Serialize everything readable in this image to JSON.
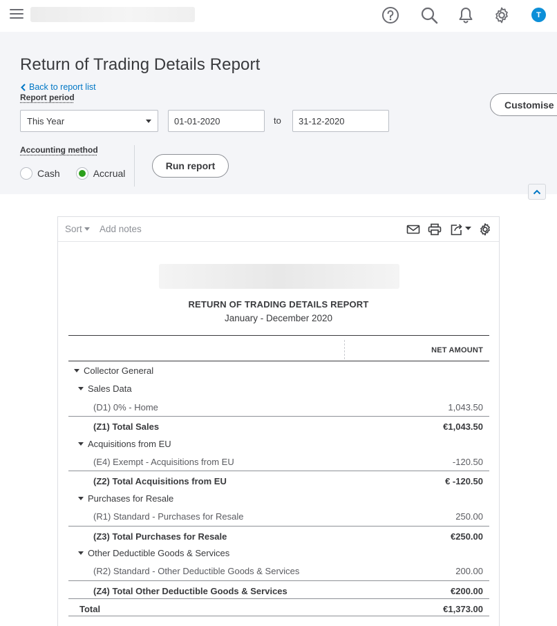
{
  "header": {
    "title": "Return of Trading Details Report",
    "back_label": "Back to report list",
    "report_period_label": "Report period",
    "period_value": "This Year",
    "start_date": "01-01-2020",
    "to_label": "to",
    "end_date": "31-12-2020",
    "customise_label": "Customise",
    "accounting_method_label": "Accounting method",
    "methods": [
      "Cash",
      "Accrual"
    ],
    "selected_method": "Accrual",
    "run_label": "Run report"
  },
  "topbar": {
    "avatar_initial": "T",
    "icons": [
      "help-icon",
      "search-icon",
      "bell-icon",
      "gear-icon"
    ]
  },
  "toolbar": {
    "sort_label": "Sort",
    "notes_label": "Add notes",
    "icons": [
      "email-icon",
      "print-icon",
      "export-icon",
      "settings-icon"
    ]
  },
  "report": {
    "title": "RETURN OF TRADING DETAILS REPORT",
    "period": "January - December 2020",
    "column_header": "NET AMOUNT",
    "rows": [
      {
        "label": "Collector General",
        "amount": "",
        "type": "group",
        "level": 0
      },
      {
        "label": "Sales Data",
        "amount": "",
        "type": "group",
        "level": 1
      },
      {
        "label": "(D1) 0% - Home",
        "amount": "1,043.50",
        "type": "detail",
        "level": 2
      },
      {
        "label": "(Z1) Total Sales",
        "amount": "€1,043.50",
        "type": "total",
        "level": 2
      },
      {
        "label": "Acquisitions from EU",
        "amount": "",
        "type": "group",
        "level": 1
      },
      {
        "label": "(E4) Exempt - Acquisitions from EU",
        "amount": "-120.50",
        "type": "detail",
        "level": 2
      },
      {
        "label": "(Z2) Total Acquisitions from EU",
        "amount": "€ -120.50",
        "type": "total",
        "level": 2
      },
      {
        "label": "Purchases for Resale",
        "amount": "",
        "type": "group",
        "level": 1
      },
      {
        "label": "(R1) Standard - Purchases for Resale",
        "amount": "250.00",
        "type": "detail",
        "level": 2
      },
      {
        "label": "(Z3) Total Purchases for Resale",
        "amount": "€250.00",
        "type": "total",
        "level": 2
      },
      {
        "label": "Other Deductible Goods & Services",
        "amount": "",
        "type": "group",
        "level": 1
      },
      {
        "label": "(R2) Standard - Other Deductible Goods & Services",
        "amount": "200.00",
        "type": "detail",
        "level": 2
      },
      {
        "label": "(Z4) Total Other Deductible Goods & Services",
        "amount": "€200.00",
        "type": "total",
        "level": 2
      },
      {
        "label": "Total",
        "amount": "€1,373.00",
        "type": "grand",
        "level": 0
      }
    ]
  },
  "colors": {
    "accent_blue": "#0077c5",
    "avatar_blue": "#0d8fd8",
    "radio_green": "#2ca01c",
    "panel_bg": "#f4f5f8"
  }
}
